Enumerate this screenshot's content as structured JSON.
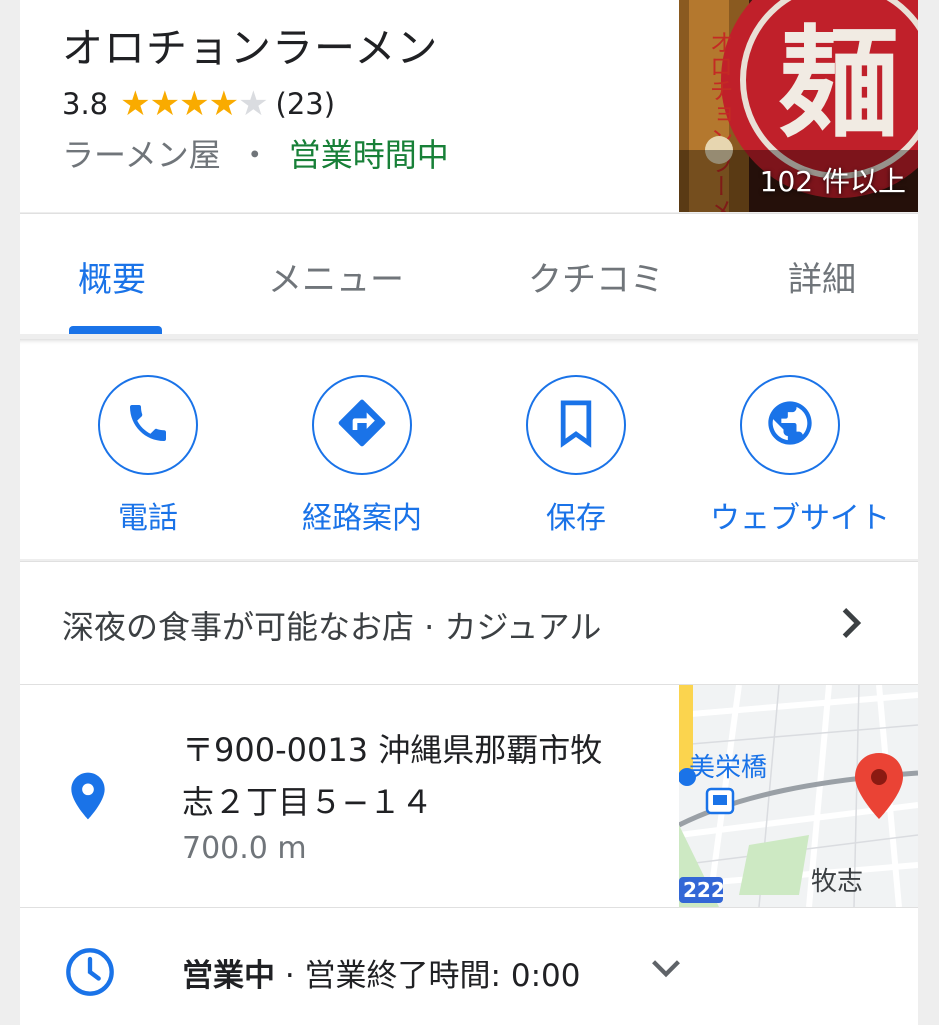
{
  "place": {
    "name": "オロチョンラーメン",
    "rating": "3.8",
    "stars_filled": 4,
    "review_count": "(23)",
    "category": "ラーメン屋",
    "separator": "・",
    "open_status": "営業時間中",
    "photo_count": "102 件以上",
    "photo_sign_text": "麺",
    "photo_vertical_text": "オロチョンラーメン"
  },
  "tabs": [
    {
      "label": "概要",
      "active": true
    },
    {
      "label": "メニュー",
      "active": false
    },
    {
      "label": "クチコミ",
      "active": false
    },
    {
      "label": "詳細",
      "active": false
    }
  ],
  "actions": [
    {
      "label": "電話",
      "icon": "phone-icon"
    },
    {
      "label": "経路案内",
      "icon": "directions-icon"
    },
    {
      "label": "保存",
      "icon": "bookmark-icon"
    },
    {
      "label": "ウェブサイト",
      "icon": "globe-icon"
    }
  ],
  "attributes": {
    "text": "深夜の食事が可能なお店 · カジュアル"
  },
  "address": {
    "line1": "〒900-0013 沖縄県那覇市牧",
    "line2": "志２丁目５−１４",
    "distance": "700.0 m",
    "map": {
      "label_station": "美栄橋",
      "label_area": "牧志",
      "route_number": "222"
    }
  },
  "hours": {
    "status": "営業中",
    "detail": " · 営業終了時間: 0:00"
  },
  "colors": {
    "accent": "#1a73e8",
    "open_green": "#188038",
    "star": "#f9ab00",
    "pin_red": "#ea4335"
  }
}
